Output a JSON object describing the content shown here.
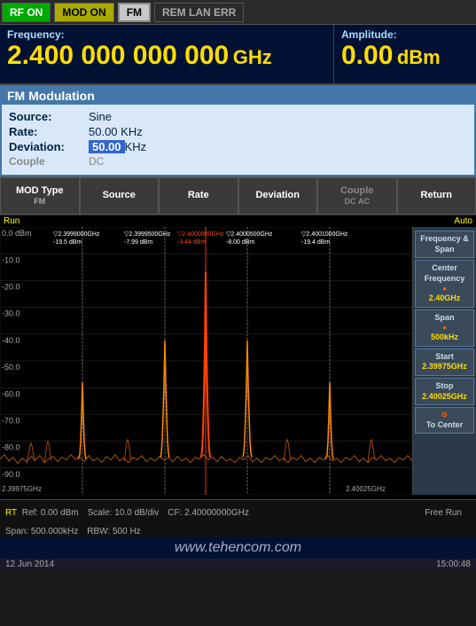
{
  "topbar": {
    "rfon": "RF ON",
    "modon": "MOD ON",
    "fm": "FM",
    "rem_lan_err": "REM LAN ERR"
  },
  "frequency": {
    "label": "Frequency:",
    "value": "2.400 000 000 000",
    "unit": "GHz"
  },
  "amplitude": {
    "label": "Amplitude:",
    "value": "0.00",
    "unit": "dBm"
  },
  "fm_modulation": {
    "title": "FM Modulation",
    "source_label": "Source:",
    "source_value": "Sine",
    "rate_label": "Rate:",
    "rate_value": "50.00 KHz",
    "deviation_label": "Deviation:",
    "deviation_value": "50.00",
    "deviation_unit": "KHz",
    "couple_label": "Couple",
    "couple_value": "DC"
  },
  "buttons": {
    "mod_type": "MOD Type",
    "mod_type_val": "FM",
    "source": "Source",
    "rate": "Rate",
    "deviation": "Deviation",
    "couple_dc": "DC",
    "couple_ac": "AC",
    "couple_label": "Couple",
    "return": "Return"
  },
  "spectrum": {
    "run_label": "Run",
    "auto_label": "Auto",
    "y_labels": [
      "0.0 dBm",
      "-10.0",
      "-20.0",
      "-30.0",
      "-40.0",
      "-50.0",
      "-60.0",
      "-70.0",
      "-80.0",
      "-90.0"
    ],
    "markers": [
      {
        "freq": "2.3999000GHz",
        "val": "-19.5 dBm"
      },
      {
        "freq": "2.3999500GHz",
        "val": "-7.99 dBm"
      },
      {
        "freq": "2.4000000GHz",
        "val": "-3.44 dBm"
      },
      {
        "freq": "2.4000500GHz",
        "val": "-8.00 dBm"
      },
      {
        "freq": "2.4001000GHz",
        "val": "-19.4 dBm"
      }
    ],
    "x_start": "2.39975GHz",
    "x_end": "2.40025GHz"
  },
  "right_panel": {
    "freq_span_label": "Frequency & Span",
    "center_freq_label": "Center Frequency",
    "center_freq_val": "2.40GHz",
    "span_label": "Span",
    "span_val": "500kHz",
    "start_label": "Start",
    "start_val": "2.39975GHz",
    "stop_label": "Stop",
    "stop_val": "2.40025GHz",
    "to_center_label": "To Center"
  },
  "status_bar": {
    "ref": "Ref: 0.00 dBm",
    "scale": "Scale: 10.0 dB/div",
    "cf": "CF: 2.40000000GHz",
    "span": "Span: 500.000kHz",
    "rbw": "RBW: 500 Hz",
    "mode": "Free Run"
  },
  "watermark": "www.tehencom.com",
  "date_bar": {
    "channel": "RT",
    "date": "12 Jun 2014",
    "time": "15:00:48"
  }
}
